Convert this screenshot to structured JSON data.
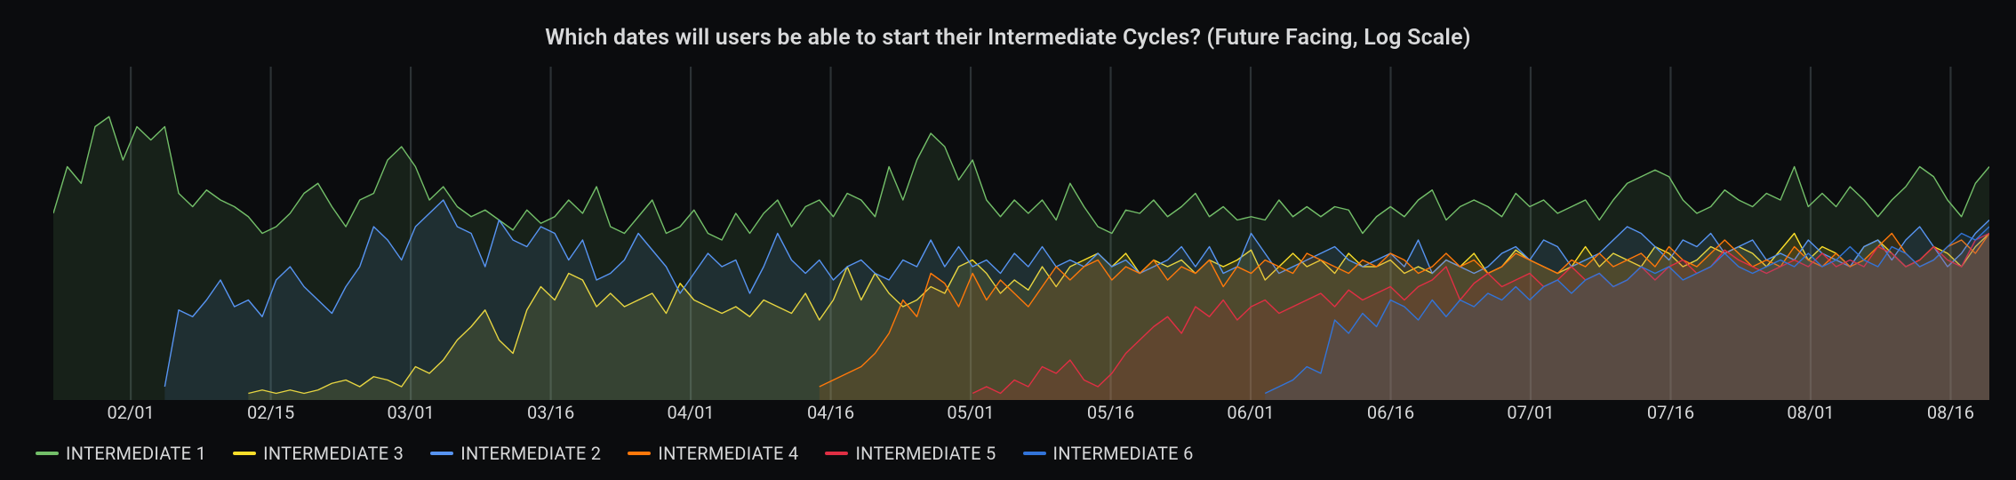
{
  "title": "Which dates will users be able to start their Intermediate Cycles? (Future Facing, Log Scale)",
  "chart_data": {
    "type": "area",
    "title": "Which dates will users be able to start their Intermediate Cycles? (Future Facing, Log Scale)",
    "xlabel": "",
    "ylabel": "",
    "log_y": true,
    "x_ticks": [
      "02/01",
      "02/15",
      "03/01",
      "03/16",
      "04/01",
      "04/16",
      "05/01",
      "05/16",
      "06/01",
      "06/16",
      "07/01",
      "07/16",
      "08/01",
      "08/16"
    ],
    "grid": true,
    "legend_position": "bottom-left",
    "ylim": [
      0,
      100
    ],
    "x_count": 140,
    "series": [
      {
        "name": "INTERMEDIATE 1",
        "color": "#73bf69",
        "start": 0,
        "values": [
          56,
          70,
          65,
          82,
          85,
          72,
          82,
          78,
          82,
          62,
          58,
          63,
          60,
          58,
          55,
          50,
          52,
          56,
          62,
          65,
          58,
          52,
          60,
          62,
          72,
          76,
          70,
          60,
          64,
          58,
          55,
          57,
          54,
          51,
          57,
          53,
          55,
          60,
          56,
          64,
          52,
          50,
          55,
          60,
          50,
          52,
          57,
          50,
          48,
          56,
          50,
          56,
          60,
          52,
          58,
          60,
          55,
          62,
          60,
          55,
          70,
          60,
          72,
          80,
          76,
          66,
          72,
          60,
          55,
          60,
          56,
          60,
          54,
          65,
          58,
          52,
          50,
          57,
          56,
          60,
          55,
          58,
          62,
          55,
          58,
          54,
          55,
          54,
          60,
          55,
          58,
          55,
          58,
          57,
          50,
          55,
          58,
          55,
          60,
          63,
          54,
          58,
          60,
          58,
          55,
          62,
          58,
          60,
          56,
          58,
          60,
          54,
          60,
          65,
          67,
          69,
          67,
          60,
          56,
          58,
          63,
          60,
          58,
          62,
          60,
          70,
          58,
          62,
          58,
          64,
          60,
          55,
          60,
          64,
          70,
          67,
          60,
          55,
          65,
          70
        ]
      },
      {
        "name": "INTERMEDIATE 3",
        "color": "#fade2a",
        "start": 14,
        "values": [
          2,
          3,
          2,
          3,
          2,
          3,
          5,
          6,
          4,
          7,
          6,
          4,
          10,
          8,
          12,
          18,
          22,
          27,
          18,
          14,
          27,
          34,
          30,
          38,
          36,
          28,
          32,
          28,
          30,
          32,
          26,
          35,
          30,
          28,
          26,
          28,
          25,
          30,
          28,
          26,
          32,
          24,
          30,
          40,
          30,
          38,
          32,
          28,
          30,
          34,
          32,
          40,
          42,
          38,
          32,
          36,
          33,
          40,
          34,
          40,
          42,
          44,
          40,
          44,
          38,
          42,
          40,
          42,
          38,
          42,
          40,
          42,
          45,
          36,
          40,
          44,
          40,
          42,
          38,
          44,
          40,
          40,
          42,
          38,
          40,
          38,
          42,
          40,
          44,
          38,
          40,
          45,
          42,
          40,
          38,
          40,
          46,
          40,
          44,
          42,
          40,
          46,
          44,
          40,
          42,
          46,
          44,
          46,
          44,
          40,
          45,
          50,
          42,
          46,
          44,
          40,
          46,
          48,
          44,
          40,
          42,
          46,
          44,
          40,
          46,
          50
        ]
      },
      {
        "name": "INTERMEDIATE 2",
        "color": "#5794f2",
        "start": 8,
        "values": [
          4,
          27,
          25,
          30,
          36,
          28,
          30,
          25,
          36,
          40,
          34,
          30,
          26,
          34,
          40,
          52,
          48,
          42,
          52,
          56,
          60,
          52,
          50,
          40,
          54,
          48,
          46,
          52,
          50,
          42,
          48,
          36,
          38,
          42,
          50,
          45,
          40,
          32,
          38,
          44,
          40,
          42,
          32,
          40,
          50,
          42,
          38,
          42,
          36,
          40,
          42,
          38,
          36,
          42,
          40,
          48,
          40,
          46,
          40,
          42,
          38,
          44,
          40,
          46,
          40,
          42,
          40,
          44,
          40,
          42,
          38,
          40,
          42,
          46,
          40,
          46,
          38,
          40,
          50,
          44,
          38,
          40,
          42,
          44,
          46,
          42,
          40,
          42,
          44,
          40,
          48,
          38,
          42,
          40,
          38,
          40,
          44,
          46,
          42,
          48,
          46,
          40,
          42,
          44,
          48,
          52,
          50,
          46,
          42,
          48,
          46,
          50,
          44,
          46,
          48,
          42,
          44,
          42,
          48,
          44,
          42,
          40,
          46,
          48,
          42,
          48,
          52,
          46,
          40,
          44,
          50,
          54
        ]
      },
      {
        "name": "INTERMEDIATE 4",
        "color": "#ff780a",
        "start": 55,
        "values": [
          4,
          6,
          8,
          10,
          14,
          20,
          30,
          25,
          38,
          35,
          28,
          38,
          30,
          36,
          32,
          28,
          34,
          40,
          36,
          40,
          42,
          36,
          40,
          38,
          42,
          36,
          40,
          38,
          42,
          34,
          40,
          38,
          42,
          40,
          38,
          44,
          42,
          40,
          38,
          42,
          40,
          44,
          42,
          38,
          40,
          44,
          40,
          42,
          38,
          40,
          44,
          42,
          40,
          38,
          42,
          40,
          44,
          40,
          42,
          44,
          40,
          46,
          42,
          40,
          44,
          48,
          44,
          40,
          42,
          40,
          46,
          42,
          40,
          44,
          40,
          42,
          46,
          50,
          44,
          40,
          42,
          46,
          48,
          44,
          50
        ]
      },
      {
        "name": "INTERMEDIATE 5",
        "color": "#e02f44",
        "start": 66,
        "values": [
          2,
          4,
          2,
          6,
          4,
          10,
          8,
          12,
          6,
          4,
          8,
          14,
          18,
          22,
          25,
          20,
          28,
          25,
          30,
          24,
          28,
          30,
          26,
          28,
          30,
          32,
          28,
          33,
          30,
          32,
          34,
          30,
          34,
          36,
          40,
          30,
          35,
          38,
          34,
          36,
          38,
          34,
          36,
          40,
          36,
          38,
          34,
          36,
          40,
          36,
          40,
          42,
          38,
          40,
          45,
          42,
          40,
          38,
          40,
          42,
          40,
          44,
          40,
          42,
          40,
          46,
          44,
          40,
          42,
          46,
          42,
          40,
          48,
          50
        ]
      },
      {
        "name": "INTERMEDIATE 6",
        "color": "#3274d9",
        "start": 87,
        "values": [
          2,
          4,
          6,
          10,
          8,
          24,
          20,
          26,
          22,
          30,
          28,
          24,
          30,
          25,
          30,
          28,
          32,
          30,
          34,
          30,
          34,
          36,
          32,
          36,
          38,
          34,
          36,
          40,
          38,
          40,
          36,
          38,
          40,
          44,
          40,
          38,
          40,
          42,
          40,
          44,
          40,
          42,
          46,
          42,
          40,
          46,
          44,
          40,
          42,
          46,
          50,
          48,
          52
        ]
      }
    ]
  },
  "legend": [
    {
      "label": "INTERMEDIATE 1",
      "color": "#73bf69"
    },
    {
      "label": "INTERMEDIATE 3",
      "color": "#fade2a"
    },
    {
      "label": "INTERMEDIATE 2",
      "color": "#5794f2"
    },
    {
      "label": "INTERMEDIATE 4",
      "color": "#ff780a"
    },
    {
      "label": "INTERMEDIATE 5",
      "color": "#e02f44"
    },
    {
      "label": "INTERMEDIATE 6",
      "color": "#3274d9"
    }
  ]
}
